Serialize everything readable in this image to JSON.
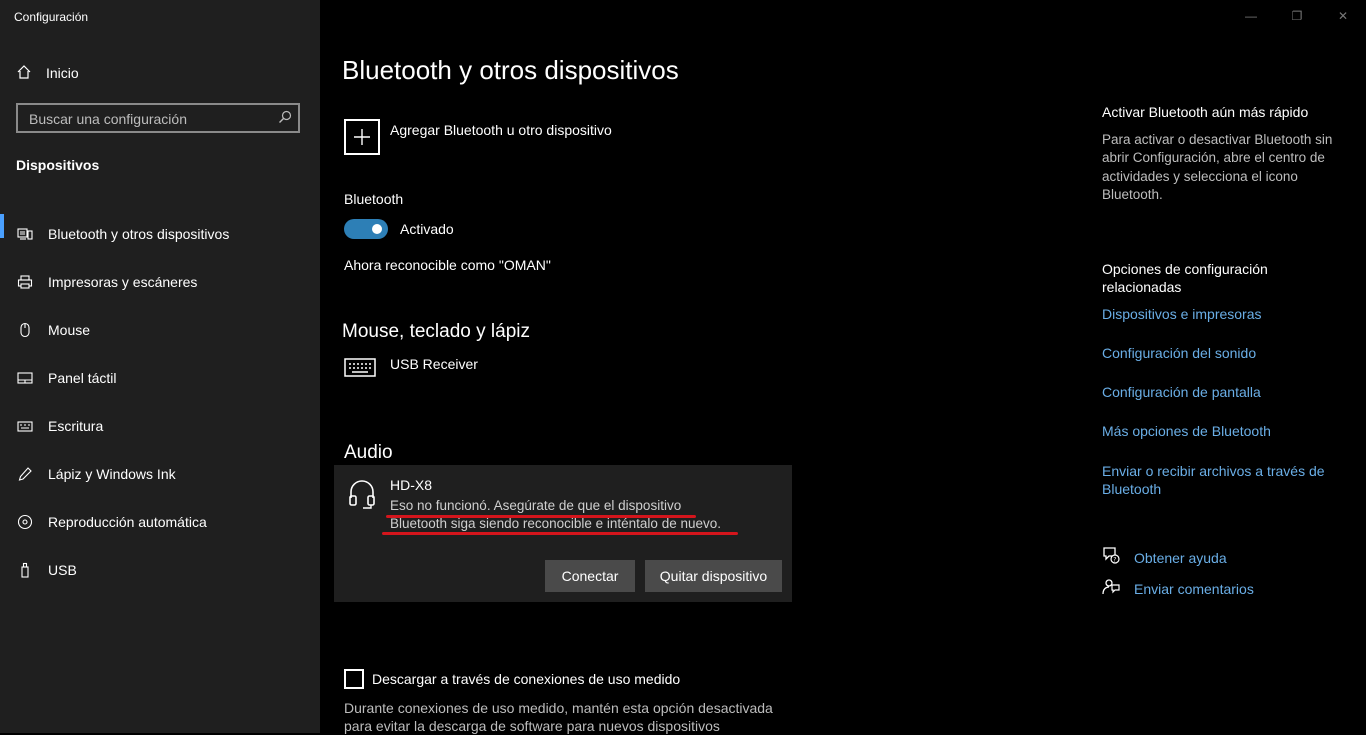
{
  "app": {
    "title": "Configuración"
  },
  "window_controls": {
    "minimize": "—",
    "maximize": "❐",
    "close": "✕"
  },
  "sidebar": {
    "home": {
      "label": "Inicio",
      "icon": "home-icon"
    },
    "search": {
      "placeholder": "Buscar una configuración",
      "icon": "search-icon"
    },
    "section": "Dispositivos",
    "items": [
      {
        "label": "Bluetooth y otros dispositivos",
        "icon": "bluetooth-devices-icon",
        "active": true
      },
      {
        "label": "Impresoras y escáneres",
        "icon": "printer-icon"
      },
      {
        "label": "Mouse",
        "icon": "mouse-icon"
      },
      {
        "label": "Panel táctil",
        "icon": "touchpad-icon"
      },
      {
        "label": "Escritura",
        "icon": "keyboard-icon"
      },
      {
        "label": "Lápiz y Windows Ink",
        "icon": "pen-icon"
      },
      {
        "label": "Reproducción automática",
        "icon": "autoplay-icon"
      },
      {
        "label": "USB",
        "icon": "usb-icon"
      }
    ]
  },
  "main": {
    "title": "Bluetooth y otros dispositivos",
    "add_device": "Agregar Bluetooth u otro dispositivo",
    "bluetooth": {
      "label": "Bluetooth",
      "state": "Activado",
      "discoverable": "Ahora reconocible como \"OMAN\""
    },
    "mouse_section": {
      "title": "Mouse, teclado y lápiz",
      "device": "USB Receiver"
    },
    "audio_section": {
      "title": "Audio",
      "device": "HD-X8",
      "error_line1": "Eso no funcionó. Asegúrate de que el dispositivo",
      "error_line2": "Bluetooth siga siendo reconocible e inténtalo de nuevo.",
      "connect": "Conectar",
      "remove": "Quitar dispositivo"
    },
    "metered": {
      "label": "Descargar a través de conexiones de uso medido",
      "desc": "Durante conexiones de uso medido, mantén esta opción desactivada para evitar la descarga de software para nuevos dispositivos"
    }
  },
  "right": {
    "tip_title": "Activar Bluetooth aún más rápido",
    "tip_body": "Para activar o desactivar Bluetooth sin abrir Configuración, abre el centro de actividades y selecciona el icono Bluetooth.",
    "related_title": "Opciones de configuración relacionadas",
    "links": [
      "Dispositivos e impresoras",
      "Configuración del sonido",
      "Configuración de pantalla",
      "Más opciones de Bluetooth",
      "Enviar o recibir archivos a través de Bluetooth"
    ],
    "help": "Obtener ayuda",
    "feedback": "Enviar comentarios"
  },
  "colors": {
    "accent": "#2d7fb6",
    "link": "#6aaee6",
    "sidebar_bg": "#1f1f1f",
    "underline": "#d4151c"
  }
}
